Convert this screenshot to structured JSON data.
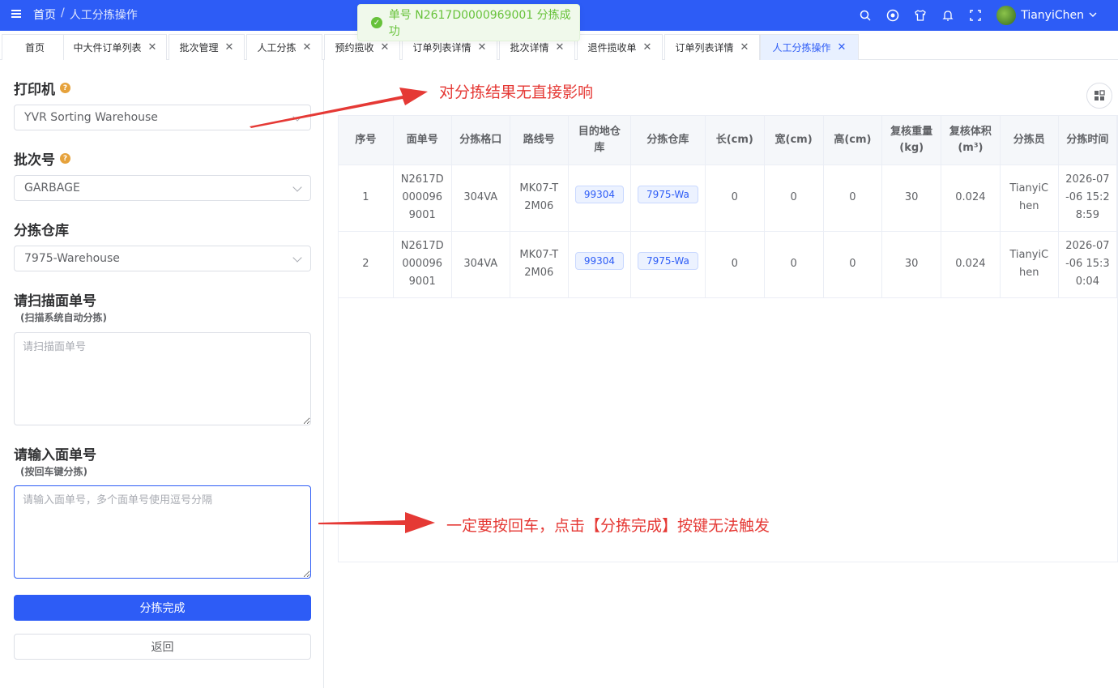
{
  "topbar": {
    "breadcrumb_home": "首页",
    "breadcrumb_sep": "/",
    "breadcrumb_current": "人工分拣操作",
    "username": "TianyiChen"
  },
  "toast": {
    "message": "单号 N2617D0000969001 分拣成功"
  },
  "tabs": [
    {
      "label": "首页"
    },
    {
      "label": "中大件订单列表"
    },
    {
      "label": "批次管理"
    },
    {
      "label": "人工分拣"
    },
    {
      "label": "预约揽收"
    },
    {
      "label": "订单列表详情"
    },
    {
      "label": "批次详情"
    },
    {
      "label": "退件揽收单"
    },
    {
      "label": "订单列表详情"
    },
    {
      "label": "人工分拣操作"
    }
  ],
  "form": {
    "printer_label": "打印机",
    "printer_value": "YVR Sorting Warehouse",
    "batch_label": "批次号",
    "batch_value": "GARBAGE",
    "warehouse_label": "分拣仓库",
    "warehouse_value": "7975-Warehouse",
    "scan_label": "请扫描面单号",
    "scan_sublabel": "(扫描系统自动分拣)",
    "scan_placeholder": "请扫描面单号",
    "input_label": "请输入面单号",
    "input_sublabel": "(按回车键分拣)",
    "input_placeholder": "请输入面单号，多个面单号使用逗号分隔",
    "complete_button": "分拣完成",
    "back_button": "返回"
  },
  "table": {
    "headers": [
      "序号",
      "面单号",
      "分拣格口",
      "路线号",
      "目的地仓库",
      "分拣仓库",
      "长(cm)",
      "宽(cm)",
      "高(cm)",
      "复核重量(kg)",
      "复核体积",
      "分拣员",
      "分拣时间"
    ],
    "volume_unit": "(m³)",
    "rows": [
      {
        "index": "1",
        "waybill": "N2617D0000969001",
        "slot": "304VA",
        "route": "MK07-T2M06",
        "dest": "99304",
        "warehouse": "7975-Wa",
        "length": "0",
        "width": "0",
        "height": "0",
        "weight": "30",
        "volume": "0.024",
        "sorter": "TianyiChen",
        "time": "2026-07-06 15:28:59"
      },
      {
        "index": "2",
        "waybill": "N2617D0000969001",
        "slot": "304VA",
        "route": "MK07-T2M06",
        "dest": "99304",
        "warehouse": "7975-Wa",
        "length": "0",
        "width": "0",
        "height": "0",
        "weight": "30",
        "volume": "0.024",
        "sorter": "TianyiChen",
        "time": "2026-07-06 15:30:04"
      }
    ]
  },
  "annotations": {
    "note1": "对分拣结果无直接影响",
    "note2": "一定要按回车，点击【分拣完成】按键无法触发"
  },
  "colors": {
    "primary": "#2d5cf6",
    "success": "#67c23a",
    "annotation": "#e53935"
  }
}
